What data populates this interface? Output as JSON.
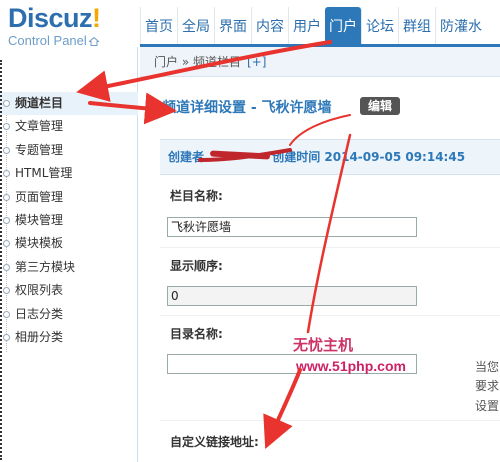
{
  "logo": {
    "brand": "Discuz",
    "bang": "!",
    "subtitle": "Control Panel"
  },
  "nav": {
    "items": [
      {
        "label": "首页"
      },
      {
        "label": "全局"
      },
      {
        "label": "界面"
      },
      {
        "label": "内容"
      },
      {
        "label": "用户"
      },
      {
        "label": "门户",
        "active": true
      },
      {
        "label": "论坛"
      },
      {
        "label": "群组"
      },
      {
        "label": "防灌水"
      }
    ]
  },
  "sidebar": {
    "items": [
      {
        "label": "频道栏目",
        "active": true
      },
      {
        "label": "文章管理"
      },
      {
        "label": "专题管理"
      },
      {
        "label": "HTML管理"
      },
      {
        "label": "页面管理"
      },
      {
        "label": "模块管理"
      },
      {
        "label": "模块模板"
      },
      {
        "label": "第三方模块"
      },
      {
        "label": "权限列表"
      },
      {
        "label": "日志分类"
      },
      {
        "label": "相册分类"
      }
    ]
  },
  "breadcrumb": {
    "text": "门户 » 频道栏目",
    "add": "[+]"
  },
  "detail": {
    "title": "频道详细设置 - 飞秋许愿墙",
    "edit_label": "编辑"
  },
  "meta": {
    "creator_label": "创建者",
    "created_label": "创建时间",
    "created_value": "2014-09-05 09:14:45"
  },
  "form": {
    "name_label": "栏目名称:",
    "name_value": "飞秋许愿墙",
    "order_label": "显示顺序:",
    "order_value": "0",
    "dir_label": "目录名称:",
    "dir_value": "",
    "dir_hint_1": "当您",
    "dir_hint_2": "要求",
    "dir_hint_3": "设置",
    "link_label": "自定义链接地址:"
  },
  "watermark": {
    "line1": "无忧主机",
    "line2": "www.51php.com"
  },
  "colors": {
    "accent": "#2d78b8",
    "arrow": "#e8332e",
    "watermark": "#cc2266"
  }
}
